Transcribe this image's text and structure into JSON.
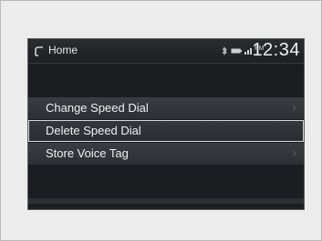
{
  "header": {
    "title": "Home",
    "time": "12:34",
    "meridiem": "PM",
    "icons": [
      "phone-icon",
      "bluetooth-icon",
      "battery-icon",
      "signal-icon"
    ]
  },
  "menu": {
    "items": [
      {
        "label": "Change Speed Dial",
        "has_submenu": true,
        "selected": false
      },
      {
        "label": "Delete Speed Dial",
        "has_submenu": false,
        "selected": true
      },
      {
        "label": "Store Voice Tag",
        "has_submenu": true,
        "selected": false
      }
    ]
  },
  "colors": {
    "screen_bg": "#1b1d20",
    "item_bg": "#3a3d42",
    "highlight_border": "#d6d8dc",
    "text": "#f0f0f0"
  }
}
